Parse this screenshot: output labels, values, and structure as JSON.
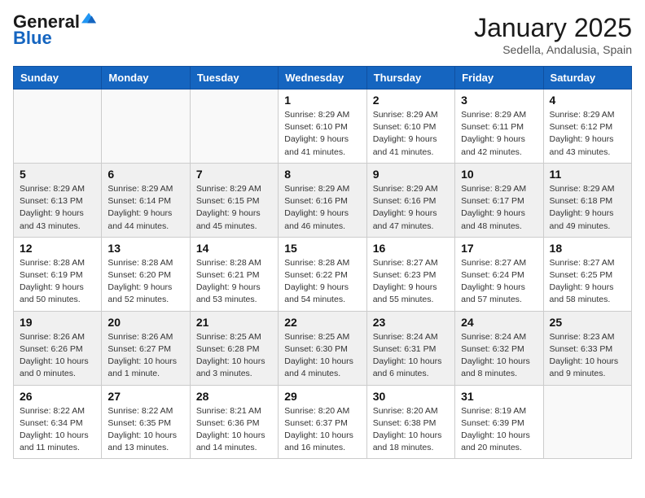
{
  "header": {
    "logo_general": "General",
    "logo_blue": "Blue",
    "month": "January 2025",
    "location": "Sedella, Andalusia, Spain"
  },
  "days_of_week": [
    "Sunday",
    "Monday",
    "Tuesday",
    "Wednesday",
    "Thursday",
    "Friday",
    "Saturday"
  ],
  "weeks": [
    [
      {
        "day": "",
        "info": ""
      },
      {
        "day": "",
        "info": ""
      },
      {
        "day": "",
        "info": ""
      },
      {
        "day": "1",
        "info": "Sunrise: 8:29 AM\nSunset: 6:10 PM\nDaylight: 9 hours and 41 minutes."
      },
      {
        "day": "2",
        "info": "Sunrise: 8:29 AM\nSunset: 6:10 PM\nDaylight: 9 hours and 41 minutes."
      },
      {
        "day": "3",
        "info": "Sunrise: 8:29 AM\nSunset: 6:11 PM\nDaylight: 9 hours and 42 minutes."
      },
      {
        "day": "4",
        "info": "Sunrise: 8:29 AM\nSunset: 6:12 PM\nDaylight: 9 hours and 43 minutes."
      }
    ],
    [
      {
        "day": "5",
        "info": "Sunrise: 8:29 AM\nSunset: 6:13 PM\nDaylight: 9 hours and 43 minutes."
      },
      {
        "day": "6",
        "info": "Sunrise: 8:29 AM\nSunset: 6:14 PM\nDaylight: 9 hours and 44 minutes."
      },
      {
        "day": "7",
        "info": "Sunrise: 8:29 AM\nSunset: 6:15 PM\nDaylight: 9 hours and 45 minutes."
      },
      {
        "day": "8",
        "info": "Sunrise: 8:29 AM\nSunset: 6:16 PM\nDaylight: 9 hours and 46 minutes."
      },
      {
        "day": "9",
        "info": "Sunrise: 8:29 AM\nSunset: 6:16 PM\nDaylight: 9 hours and 47 minutes."
      },
      {
        "day": "10",
        "info": "Sunrise: 8:29 AM\nSunset: 6:17 PM\nDaylight: 9 hours and 48 minutes."
      },
      {
        "day": "11",
        "info": "Sunrise: 8:29 AM\nSunset: 6:18 PM\nDaylight: 9 hours and 49 minutes."
      }
    ],
    [
      {
        "day": "12",
        "info": "Sunrise: 8:28 AM\nSunset: 6:19 PM\nDaylight: 9 hours and 50 minutes."
      },
      {
        "day": "13",
        "info": "Sunrise: 8:28 AM\nSunset: 6:20 PM\nDaylight: 9 hours and 52 minutes."
      },
      {
        "day": "14",
        "info": "Sunrise: 8:28 AM\nSunset: 6:21 PM\nDaylight: 9 hours and 53 minutes."
      },
      {
        "day": "15",
        "info": "Sunrise: 8:28 AM\nSunset: 6:22 PM\nDaylight: 9 hours and 54 minutes."
      },
      {
        "day": "16",
        "info": "Sunrise: 8:27 AM\nSunset: 6:23 PM\nDaylight: 9 hours and 55 minutes."
      },
      {
        "day": "17",
        "info": "Sunrise: 8:27 AM\nSunset: 6:24 PM\nDaylight: 9 hours and 57 minutes."
      },
      {
        "day": "18",
        "info": "Sunrise: 8:27 AM\nSunset: 6:25 PM\nDaylight: 9 hours and 58 minutes."
      }
    ],
    [
      {
        "day": "19",
        "info": "Sunrise: 8:26 AM\nSunset: 6:26 PM\nDaylight: 10 hours and 0 minutes."
      },
      {
        "day": "20",
        "info": "Sunrise: 8:26 AM\nSunset: 6:27 PM\nDaylight: 10 hours and 1 minute."
      },
      {
        "day": "21",
        "info": "Sunrise: 8:25 AM\nSunset: 6:28 PM\nDaylight: 10 hours and 3 minutes."
      },
      {
        "day": "22",
        "info": "Sunrise: 8:25 AM\nSunset: 6:30 PM\nDaylight: 10 hours and 4 minutes."
      },
      {
        "day": "23",
        "info": "Sunrise: 8:24 AM\nSunset: 6:31 PM\nDaylight: 10 hours and 6 minutes."
      },
      {
        "day": "24",
        "info": "Sunrise: 8:24 AM\nSunset: 6:32 PM\nDaylight: 10 hours and 8 minutes."
      },
      {
        "day": "25",
        "info": "Sunrise: 8:23 AM\nSunset: 6:33 PM\nDaylight: 10 hours and 9 minutes."
      }
    ],
    [
      {
        "day": "26",
        "info": "Sunrise: 8:22 AM\nSunset: 6:34 PM\nDaylight: 10 hours and 11 minutes."
      },
      {
        "day": "27",
        "info": "Sunrise: 8:22 AM\nSunset: 6:35 PM\nDaylight: 10 hours and 13 minutes."
      },
      {
        "day": "28",
        "info": "Sunrise: 8:21 AM\nSunset: 6:36 PM\nDaylight: 10 hours and 14 minutes."
      },
      {
        "day": "29",
        "info": "Sunrise: 8:20 AM\nSunset: 6:37 PM\nDaylight: 10 hours and 16 minutes."
      },
      {
        "day": "30",
        "info": "Sunrise: 8:20 AM\nSunset: 6:38 PM\nDaylight: 10 hours and 18 minutes."
      },
      {
        "day": "31",
        "info": "Sunrise: 8:19 AM\nSunset: 6:39 PM\nDaylight: 10 hours and 20 minutes."
      },
      {
        "day": "",
        "info": ""
      }
    ]
  ]
}
